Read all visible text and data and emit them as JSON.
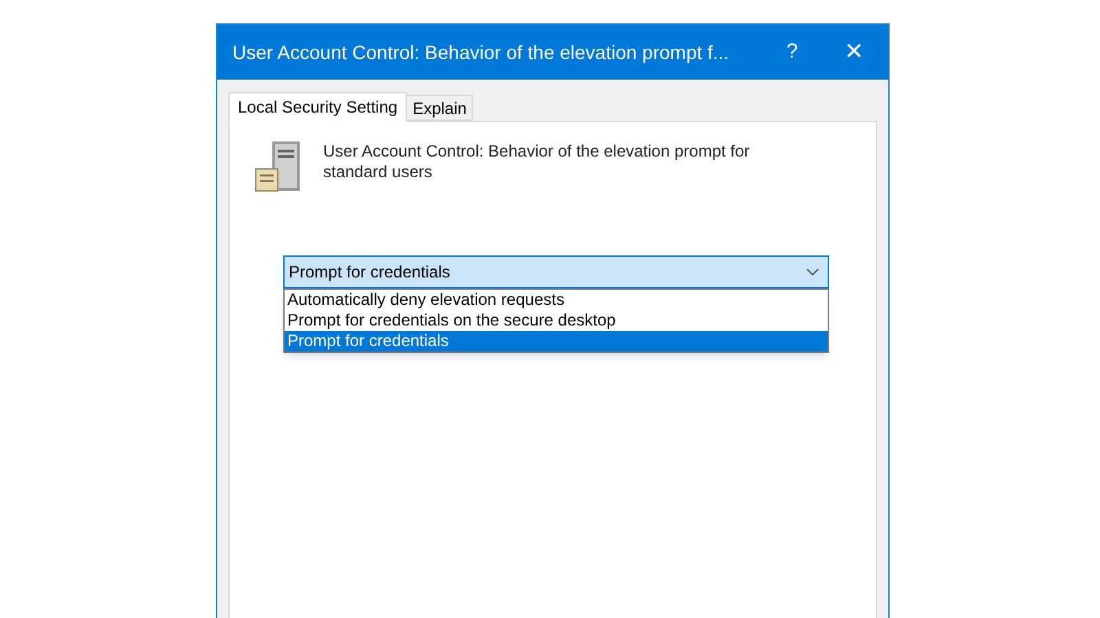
{
  "window": {
    "title": "User Account Control: Behavior of the elevation prompt f...",
    "help": "?",
    "close": "✕"
  },
  "tabs": [
    {
      "label": "Local Security Setting",
      "selected": true
    },
    {
      "label": "Explain",
      "selected": false
    }
  ],
  "policy": {
    "description": "User Account Control: Behavior of the elevation prompt for standard users"
  },
  "dropdown": {
    "value": "Prompt for credentials",
    "expanded": true,
    "options": [
      {
        "label": "Automatically deny elevation requests",
        "selected": false
      },
      {
        "label": "Prompt for credentials on the secure desktop",
        "selected": false
      },
      {
        "label": "Prompt for credentials",
        "selected": true
      }
    ]
  }
}
